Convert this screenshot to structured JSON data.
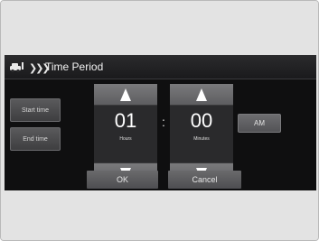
{
  "header": {
    "title": "Time Period",
    "car_icon": "car-icon",
    "nav_icon": "triple-chevron-icon"
  },
  "side": {
    "start_label": "Start time",
    "end_label": "End time"
  },
  "hours": {
    "value": "01",
    "unit": "Hours"
  },
  "minutes": {
    "value": "00",
    "unit": "Minutes"
  },
  "colon": ":",
  "ampm": {
    "label": "AM"
  },
  "actions": {
    "ok": "OK",
    "cancel": "Cancel"
  },
  "colors": {
    "screen_bg": "#0f0f10",
    "button": "#5f5f62",
    "text": "#ffffff",
    "frame_bg": "#e3e3e3"
  }
}
